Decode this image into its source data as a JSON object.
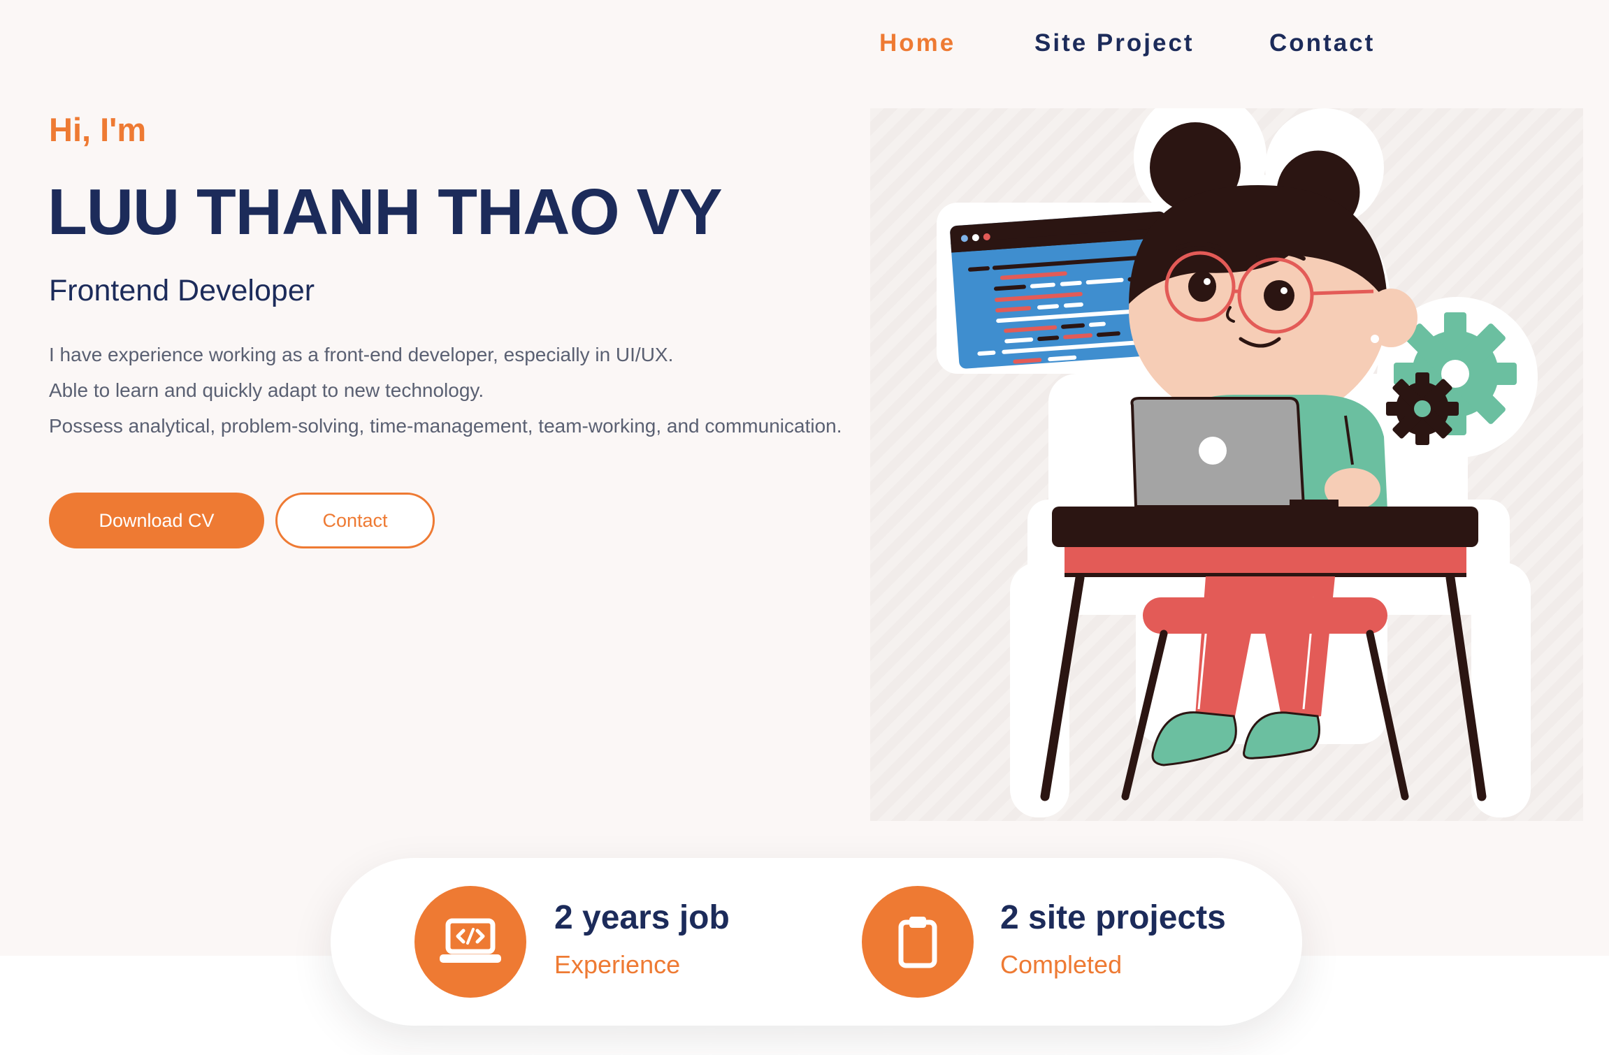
{
  "nav": {
    "items": [
      {
        "label": "Home",
        "active": true
      },
      {
        "label": "Site Project",
        "active": false
      },
      {
        "label": "Contact",
        "active": false
      }
    ]
  },
  "hero": {
    "greeting": "Hi, I'm",
    "name": "LUU THANH THAO VY",
    "role": "Frontend Developer",
    "description": [
      "I have experience working as a front-end developer, especially in UI/UX.",
      "Able to learn and quickly adapt to new technology.",
      "Possess analytical, problem-solving, time-management, team-working, and communication."
    ],
    "download_label": "Download CV",
    "contact_label": "Contact",
    "illustration": "developer-girl-illustration"
  },
  "stats": [
    {
      "value": "2 years job",
      "label": "Experience",
      "icon": "laptop-code-icon"
    },
    {
      "value": "2 site projects",
      "label": "Completed",
      "icon": "clipboard-icon"
    }
  ],
  "colors": {
    "accent": "#ee7a33",
    "navy": "#1c2b5a",
    "background": "#fbf7f6"
  }
}
